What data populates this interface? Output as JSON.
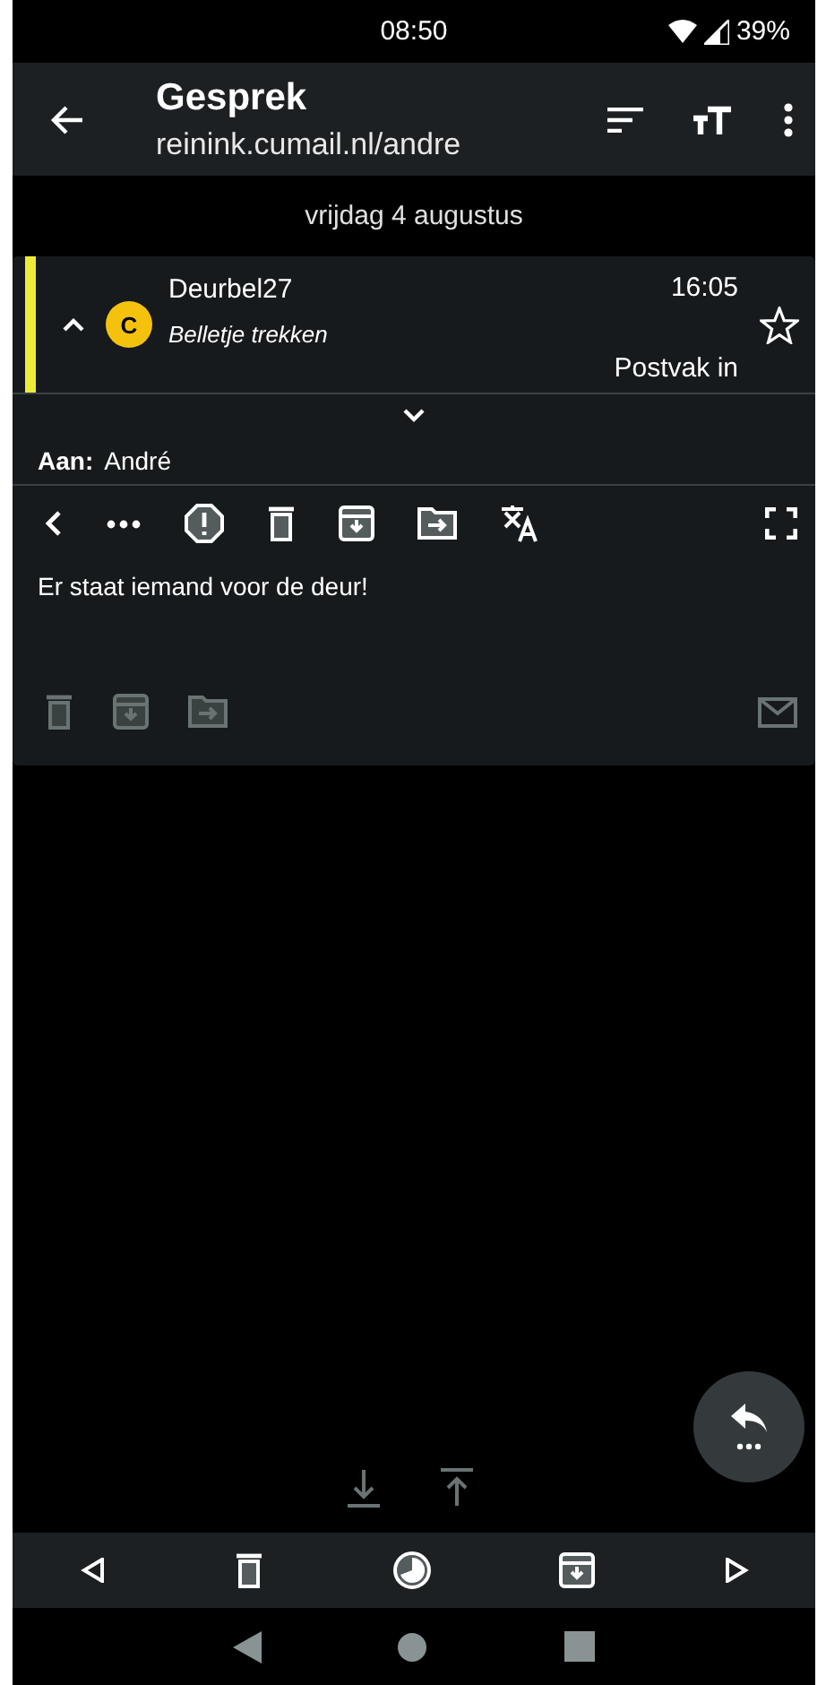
{
  "status_bar": {
    "time": "08:50",
    "battery": "39%"
  },
  "app_bar": {
    "title": "Gesprek",
    "subtitle": "reinink.cumail.nl/andre"
  },
  "date_header": "vrijdag 4 augustus",
  "message": {
    "sender": "Deurbel27",
    "subject": "Belletje trekken",
    "time": "16:05",
    "folder": "Postvak in",
    "avatar_letter": "C",
    "starred": false,
    "to_label": "Aan:",
    "to": "André",
    "body": "Er staat iemand voor de deur!"
  }
}
